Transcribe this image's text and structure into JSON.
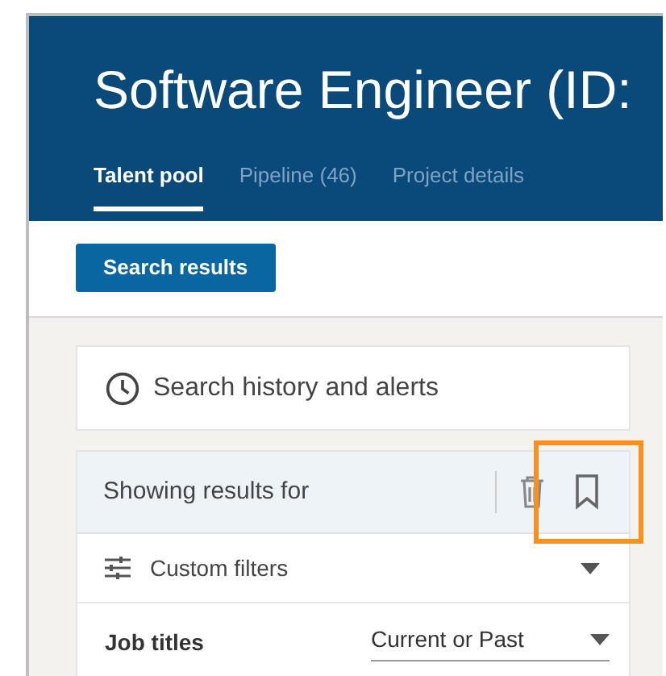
{
  "header": {
    "title": "Software Engineer (ID:"
  },
  "tabs": [
    {
      "label": "Talent pool",
      "selected": true
    },
    {
      "label": "Pipeline (46)",
      "selected": false
    },
    {
      "label": "Project details",
      "selected": false
    }
  ],
  "primary_button": "Search results",
  "history": {
    "label": "Search history and alerts"
  },
  "results_panel": {
    "heading": "Showing results for",
    "save_highlighted": true,
    "filters_label": "Custom filters",
    "rows": [
      {
        "label": "Job titles",
        "select": "Current or Past"
      }
    ]
  }
}
